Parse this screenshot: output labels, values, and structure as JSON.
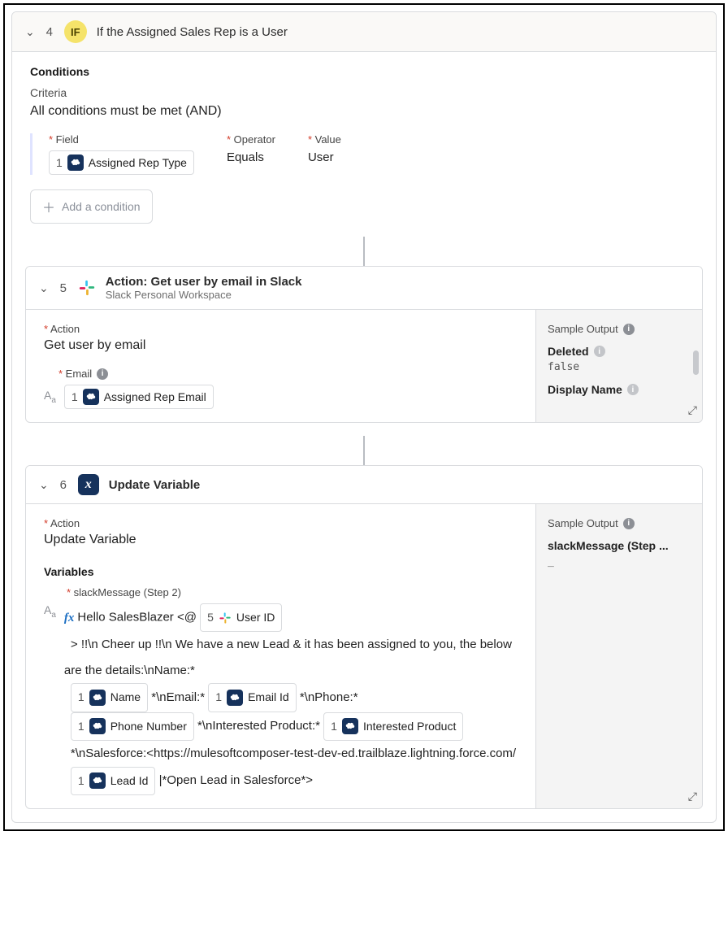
{
  "step4": {
    "num": "4",
    "if": "IF",
    "title": "If the Assigned Sales Rep is a User",
    "conditions_label": "Conditions",
    "criteria_label": "Criteria",
    "logic": "All conditions must be met (AND)",
    "field_label": "Field",
    "operator_label": "Operator",
    "value_label": "Value",
    "field_pill_num": "1",
    "field_pill_text": "Assigned Rep Type",
    "operator_value": "Equals",
    "value_value": "User",
    "add_condition": "Add a condition"
  },
  "step5": {
    "num": "5",
    "title": "Action: Get user by email in Slack",
    "subtitle": "Slack Personal Workspace",
    "action_label": "Action",
    "action_value": "Get user by email",
    "email_label": "Email",
    "email_pill_num": "1",
    "email_pill_text": "Assigned Rep Email",
    "sample_output_label": "Sample Output",
    "so_key1": "Deleted",
    "so_val1": "false",
    "so_key2": "Display Name"
  },
  "step6": {
    "num": "6",
    "var_glyph": "x",
    "title": "Update Variable",
    "action_label": "Action",
    "action_value": "Update Variable",
    "variables_label": "Variables",
    "var_name": "slackMessage (Step 2)",
    "fx": "fx",
    "t_hello": "Hello SalesBlazer <@",
    "chip_userid_num": "5",
    "chip_userid_text": "User ID",
    "t_line2": "> !!\\n Cheer up !!\\n We have a new Lead & it has been assigned to you, the below are the details:\\nName:*",
    "chip_name_num": "1",
    "chip_name_text": "Name",
    "t_email": "*\\nEmail:*",
    "chip_email_num": "1",
    "chip_email_text": "Email Id",
    "t_phone": "*\\nPhone:*",
    "chip_phone_num": "1",
    "chip_phone_text": "Phone Number",
    "t_prod": "*\\nInterested Product:*",
    "chip_prod_num": "1",
    "chip_prod_text": "Interested Product",
    "t_sf": "*\\nSalesforce:<https://mulesoftcomposer-test-dev-ed.trailblaze.lightning.force.com/",
    "chip_lead_num": "1",
    "chip_lead_text": "Lead Id",
    "t_end": "|*Open Lead in Salesforce*>",
    "sample_output_label": "Sample Output",
    "so_key1": "slackMessage (Step ...",
    "so_val1": "_"
  }
}
